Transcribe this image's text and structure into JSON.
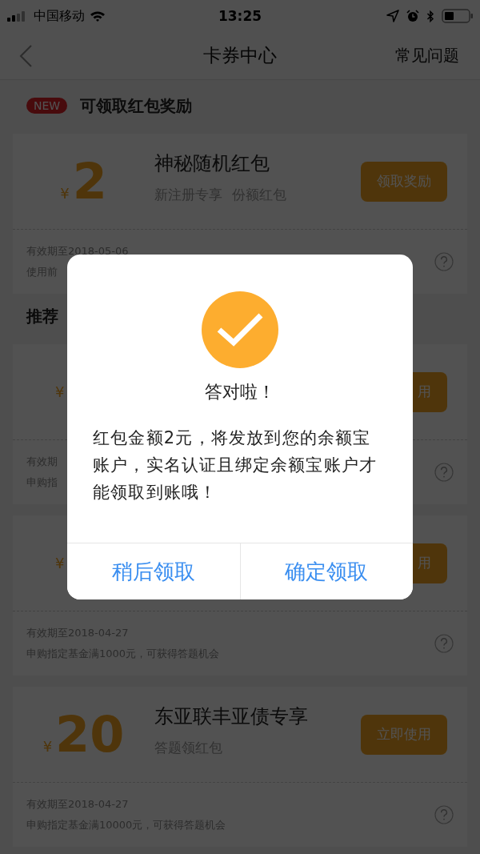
{
  "status_bar": {
    "carrier": "中国移动",
    "time": "13:25"
  },
  "nav": {
    "title": "卡券中心",
    "action": "常见问题"
  },
  "sections": [
    {
      "badge": "NEW",
      "title": "可领取红包奖励",
      "cards": [
        {
          "currency": "¥",
          "amount": "2",
          "title": "神秘随机红包",
          "tags": [
            "新注册专享",
            "份额红包"
          ],
          "button": "领取奖励",
          "expiry": "有效期至2018-05-06",
          "condition": "使用前"
        }
      ]
    },
    {
      "title": "推荐",
      "cards": [
        {
          "currency": "¥",
          "button": "用",
          "expiry": "有效期",
          "condition": "申购指"
        },
        {
          "currency": "¥",
          "button": "用",
          "expiry": "有效期至2018-04-27",
          "condition": "申购指定基金满1000元，可获得答题机会"
        },
        {
          "currency": "¥",
          "amount": "20",
          "title": "东亚联丰亚债专享",
          "tags": [
            "答题领红包"
          ],
          "button": "立即使用",
          "expiry": "有效期至2018-04-27",
          "condition": "申购指定基金满10000元，可获得答题机会"
        }
      ]
    }
  ],
  "dialog": {
    "title": "答对啦！",
    "message": "红包金额2元，将发放到您的余额宝账户，实名认证且绑定余额宝账户才能领取到账哦！",
    "buttons": [
      "稍后领取",
      "确定领取"
    ]
  }
}
